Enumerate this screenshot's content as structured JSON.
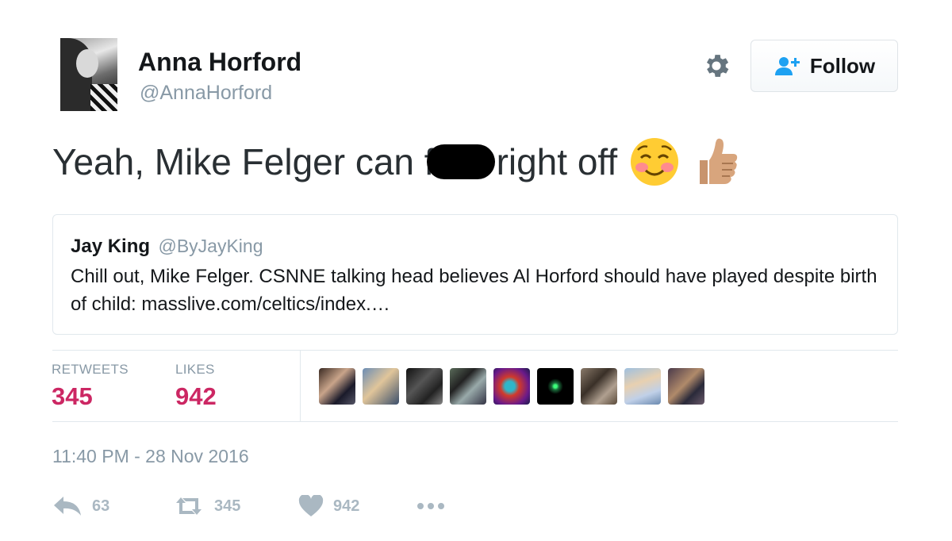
{
  "user": {
    "name": "Anna Horford",
    "handle": "@AnnaHorford"
  },
  "follow": {
    "label": "Follow"
  },
  "tweet": {
    "text_before": "Yeah, Mike Felger can f",
    "text_after": "right off",
    "emojis": [
      "😊",
      "👍"
    ]
  },
  "quoted": {
    "name": "Jay King",
    "handle": "@ByJayKing",
    "text": "Chill out, Mike Felger. CSNNE talking head believes Al Horford should have played despite birth of child: masslive.com/celtics/index.…"
  },
  "stats": {
    "retweets_label": "RETWEETS",
    "retweets": "345",
    "likes_label": "LIKES",
    "likes": "942"
  },
  "timestamp": "11:40 PM - 28 Nov 2016",
  "actions": {
    "reply_count": "63",
    "retweet_count": "345",
    "like_count": "942"
  },
  "icons": {
    "gear": "gear-icon",
    "follow": "add-user-icon",
    "reply": "reply-icon",
    "retweet": "retweet-icon",
    "like": "heart-icon",
    "more": "more-icon"
  },
  "colors": {
    "stat_value": "#cc2763",
    "muted": "#8899a6",
    "action_gray": "#aab8c2",
    "follow_icon": "#1da1f2"
  }
}
